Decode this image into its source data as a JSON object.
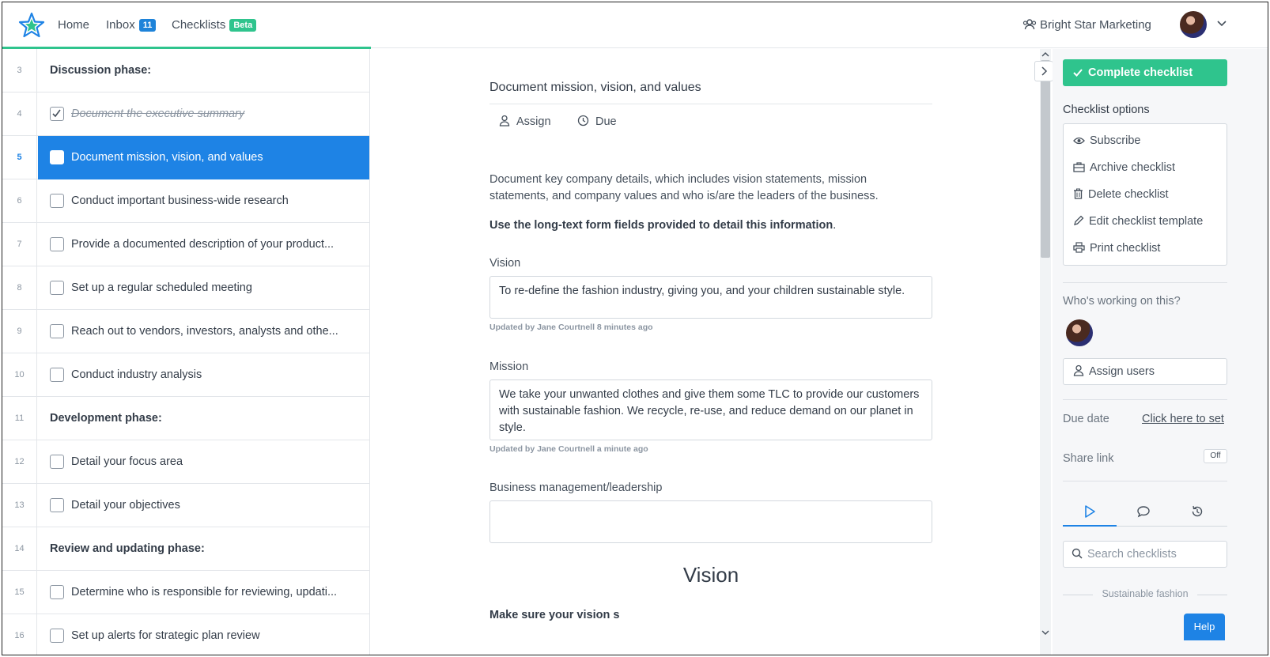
{
  "nav": {
    "home": "Home",
    "inbox": "Inbox",
    "inbox_count": "11",
    "checklists": "Checklists",
    "checklists_badge": "Beta",
    "org_name": "Bright Star Marketing"
  },
  "tasks": [
    {
      "num": "3",
      "type": "heading",
      "label": "Discussion phase:"
    },
    {
      "num": "4",
      "type": "task",
      "label": "Document the executive summary",
      "done": true
    },
    {
      "num": "5",
      "type": "task",
      "label": "Document mission, vision, and values",
      "active": true
    },
    {
      "num": "6",
      "type": "task",
      "label": "Conduct important business-wide research"
    },
    {
      "num": "7",
      "type": "task",
      "label": "Provide a documented description of your product..."
    },
    {
      "num": "8",
      "type": "task",
      "label": "Set up a regular scheduled meeting"
    },
    {
      "num": "9",
      "type": "task",
      "label": "Reach out to vendors, investors, analysts and othe..."
    },
    {
      "num": "10",
      "type": "task",
      "label": "Conduct industry analysis"
    },
    {
      "num": "11",
      "type": "heading",
      "label": "Development phase:"
    },
    {
      "num": "12",
      "type": "task",
      "label": "Detail your focus area"
    },
    {
      "num": "13",
      "type": "task",
      "label": "Detail your objectives"
    },
    {
      "num": "14",
      "type": "heading",
      "label": "Review and updating phase:"
    },
    {
      "num": "15",
      "type": "task",
      "label": "Determine who is responsible for reviewing, updati..."
    },
    {
      "num": "16",
      "type": "task",
      "label": "Set up alerts for strategic plan review"
    }
  ],
  "detail": {
    "title": "Document mission, vision, and values",
    "assign": "Assign",
    "due": "Due",
    "description": "Document key company details, which includes vision statements, mission statements, and company values and who is/are the leaders of the business.",
    "instruction_bold": "Use the long-text form fields provided to detail this information",
    "instruction_end": ".",
    "fields": {
      "vision_label": "Vision",
      "vision_value": "To re-define the fashion industry, giving you, and your children sustainable style.",
      "vision_updated": "Updated by Jane Courtnell 8 minutes ago",
      "mission_label": "Mission",
      "mission_value": "We take your unwanted clothes and give them some TLC to provide our customers with sustainable fashion. We recycle, re-use, and reduce demand on our planet in style.",
      "mission_updated": "Updated by Jane Courtnell a minute ago",
      "leadership_label": "Business management/leadership",
      "leadership_value": ""
    },
    "section_heading": "Vision",
    "section_subhead": "Make sure your vision s"
  },
  "panel": {
    "complete": "Complete checklist",
    "options_title": "Checklist options",
    "options": [
      "Subscribe",
      "Archive checklist",
      "Delete checklist",
      "Edit checklist template",
      "Print checklist"
    ],
    "working_title": "Who's working on this?",
    "assign_users": "Assign users",
    "due_date_label": "Due date",
    "due_date_link": "Click here to set",
    "share_link_label": "Share link",
    "share_link_state": "Off",
    "search_placeholder": "Search checklists",
    "divider": "Sustainable fashion",
    "help": "Help"
  },
  "colors": {
    "accent_green": "#2fc48d",
    "accent_blue": "#1e83e5"
  }
}
